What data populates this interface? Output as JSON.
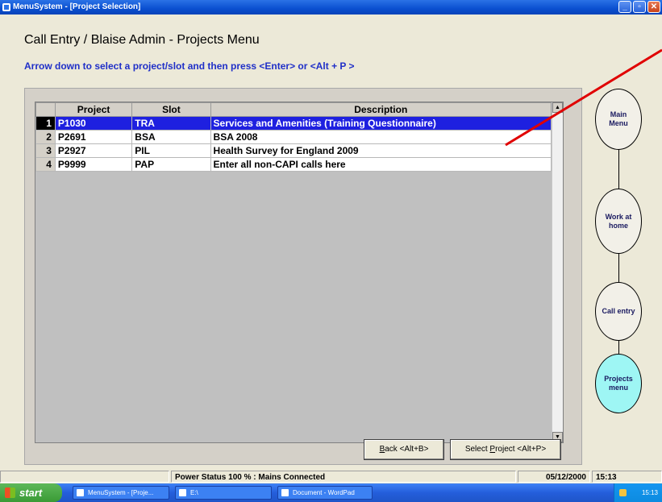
{
  "window": {
    "title": "MenuSystem - [Project Selection]",
    "controls": [
      "minimize",
      "maximize",
      "close"
    ]
  },
  "header": {
    "title": "Call Entry / Blaise Admin - Projects Menu",
    "instruction": "Arrow down to select a project/slot and then press <Enter> or <Alt + P >"
  },
  "grid": {
    "columns": [
      "Project",
      "Slot",
      "Description"
    ],
    "rows": [
      {
        "num": "1",
        "project": "P1030",
        "slot": "TRA",
        "description": "Services and Amenities (Training Questionnaire)",
        "selected": true
      },
      {
        "num": "2",
        "project": "P2691",
        "slot": "BSA",
        "description": "BSA 2008"
      },
      {
        "num": "3",
        "project": "P2927",
        "slot": "PIL",
        "description": "Health Survey for England 2009"
      },
      {
        "num": "4",
        "project": "P9999",
        "slot": "PAP",
        "description": "Enter all non-CAPI calls here"
      }
    ]
  },
  "buttons": {
    "back": {
      "label_pre": "",
      "accel": "B",
      "label_post": "ack <Alt+B>"
    },
    "select": {
      "label_pre": "Select ",
      "accel": "P",
      "label_post": "roject <Alt+P>"
    }
  },
  "flow": {
    "nodes": [
      {
        "label": "Main Menu"
      },
      {
        "label": "Work at home"
      },
      {
        "label": "Call entry"
      },
      {
        "label": "Projects menu",
        "active": true
      }
    ],
    "active_color": "#9EF6F4"
  },
  "statusbar": {
    "power": "Power Status 100 % : Mains Connected",
    "date": "05/12/2000",
    "time": "15:13"
  },
  "taskbar": {
    "start_label": "start",
    "tasks": [
      "MenuSystem - [Proje...",
      "E:\\",
      "Document - WordPad"
    ],
    "clock": "15:13"
  },
  "colors": {
    "selection": "#1E20E0",
    "instruction_text": "#1F2FC8",
    "annotation_line": "#E00000"
  }
}
